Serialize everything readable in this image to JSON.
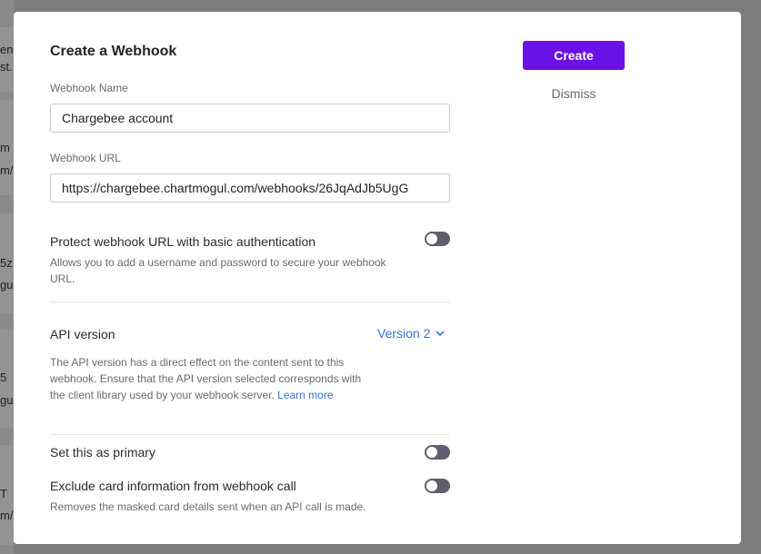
{
  "background": {
    "fragments": [
      "ent",
      "st.",
      "m",
      "m/",
      "5z",
      "gul",
      "5",
      "gul",
      "T",
      "m/"
    ]
  },
  "modal": {
    "title": "Create a Webhook",
    "create_label": "Create",
    "dismiss_label": "Dismiss",
    "name_field": {
      "label": "Webhook Name",
      "value": "Chargebee account"
    },
    "url_field": {
      "label": "Webhook URL",
      "value": "https://chargebee.chartmogul.com/webhooks/26JqAdJb5UgG"
    },
    "basic_auth": {
      "label": "Protect webhook URL with basic authentication",
      "help": "Allows you to add a username and password to secure your webhook URL.",
      "enabled": false
    },
    "api_version": {
      "label": "API version",
      "selected": "Version 2",
      "help": "The API version has a direct effect on the content sent to this webhook. Ensure that the API version selected corresponds with the client library used by your webhook server.",
      "link_label": "Learn more"
    },
    "primary": {
      "label": "Set this as primary",
      "enabled": false
    },
    "exclude_card": {
      "label": "Exclude card information from webhook call",
      "help": "Removes the masked card details sent when an API call is made.",
      "enabled": false
    }
  },
  "colors": {
    "accent": "#6a11e6",
    "link": "#3b6dd8",
    "toggle_off": "#5e5e6e",
    "overlay": "#7d7d7f"
  }
}
